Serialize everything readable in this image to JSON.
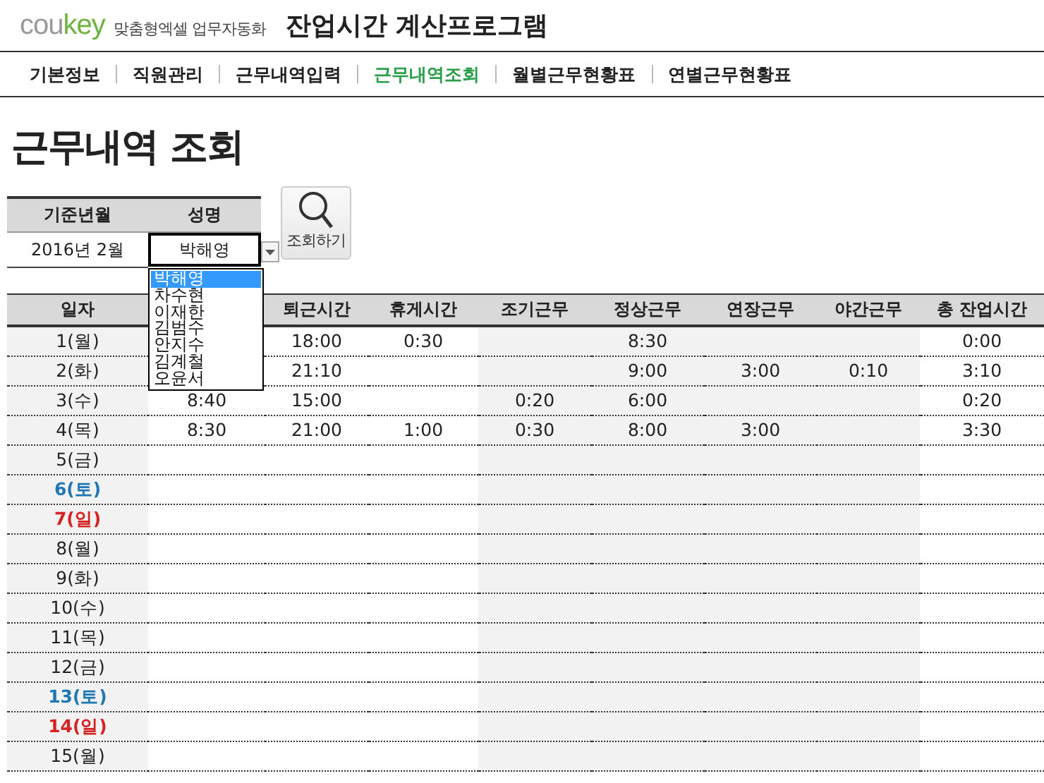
{
  "header": {
    "logo_gray": "cou",
    "logo_green": "key",
    "tagline": "맞춤형엑셀 업무자동화",
    "title": "잔업시간 계산프로그램"
  },
  "nav": [
    {
      "label": "기본정보",
      "selected": false
    },
    {
      "label": "직원관리",
      "selected": false
    },
    {
      "label": "근무내역입력",
      "selected": false
    },
    {
      "label": "근무내역조회",
      "selected": true
    },
    {
      "label": "월별근무현황표",
      "selected": false
    },
    {
      "label": "연별근무현황표",
      "selected": false
    }
  ],
  "page_title": "근무내역 조회",
  "filter": {
    "month_label": "기준년월",
    "name_label": "성명",
    "month_value": "2016년 2월",
    "name_value": "박해영",
    "search_button": "조회하기",
    "dropdown": [
      {
        "label": "박해영",
        "selected": true
      },
      {
        "label": "차수현",
        "selected": false
      },
      {
        "label": "이재한",
        "selected": false
      },
      {
        "label": "김범수",
        "selected": false
      },
      {
        "label": "안지수",
        "selected": false
      },
      {
        "label": "김계철",
        "selected": false
      },
      {
        "label": "오윤서",
        "selected": false
      }
    ]
  },
  "table": {
    "columns": [
      "일자",
      "",
      "퇴근시간",
      "휴게시간",
      "조기근무",
      "정상근무",
      "연장근무",
      "야간근무",
      "총 잔업시간"
    ],
    "rows": [
      {
        "kind": "weekday",
        "cells": [
          "1(월)",
          "",
          "18:00",
          "0:30",
          "",
          "8:30",
          "",
          "",
          "0:00"
        ]
      },
      {
        "kind": "weekday",
        "cells": [
          "2(화)",
          "",
          "21:10",
          "",
          "",
          "9:00",
          "3:00",
          "0:10",
          "3:10"
        ]
      },
      {
        "kind": "weekday",
        "cells": [
          "3(수)",
          "8:40",
          "15:00",
          "",
          "0:20",
          "6:00",
          "",
          "",
          "0:20"
        ]
      },
      {
        "kind": "weekday",
        "cells": [
          "4(목)",
          "8:30",
          "21:00",
          "1:00",
          "0:30",
          "8:00",
          "3:00",
          "",
          "3:30"
        ]
      },
      {
        "kind": "weekday",
        "cells": [
          "5(금)"
        ]
      },
      {
        "kind": "saturday",
        "cells": [
          "6(토)"
        ]
      },
      {
        "kind": "sunday",
        "cells": [
          "7(일)"
        ]
      },
      {
        "kind": "weekday",
        "cells": [
          "8(월)"
        ]
      },
      {
        "kind": "weekday",
        "cells": [
          "9(화)"
        ]
      },
      {
        "kind": "weekday",
        "cells": [
          "10(수)"
        ]
      },
      {
        "kind": "weekday",
        "cells": [
          "11(목)"
        ]
      },
      {
        "kind": "weekday",
        "cells": [
          "12(금)"
        ]
      },
      {
        "kind": "saturday",
        "cells": [
          "13(토)"
        ]
      },
      {
        "kind": "sunday",
        "cells": [
          "14(일)"
        ]
      },
      {
        "kind": "weekday",
        "cells": [
          "15(월)"
        ]
      }
    ]
  }
}
